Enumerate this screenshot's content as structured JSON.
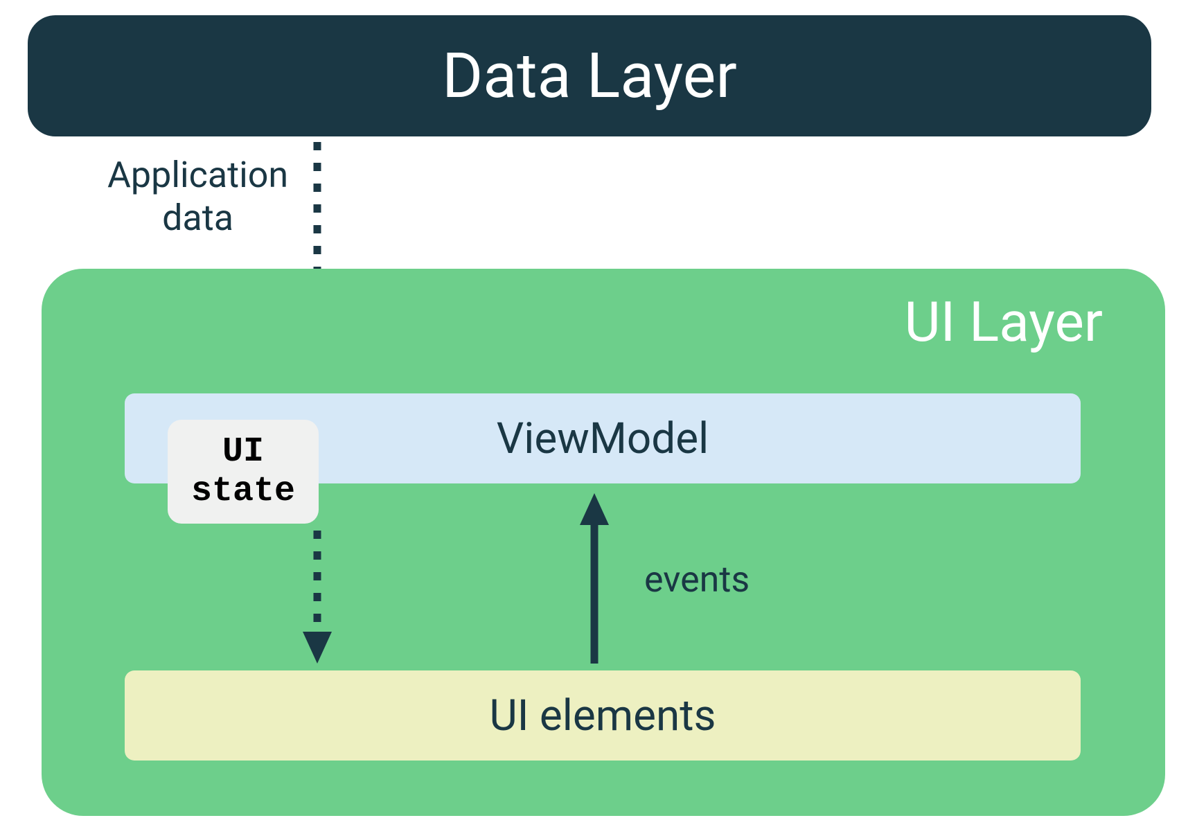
{
  "boxes": {
    "data_layer": "Data Layer",
    "ui_layer": "UI Layer",
    "viewmodel": "ViewModel",
    "ui_state_line1": "UI",
    "ui_state_line2": "state",
    "ui_elements": "UI elements"
  },
  "labels": {
    "application_data_line1": "Application",
    "application_data_line2": "data",
    "events": "events"
  },
  "colors": {
    "dark_navy": "#1a3744",
    "green": "#6dcf8b",
    "light_blue": "#d6e8f7",
    "light_yellow": "#edf0c1",
    "light_gray": "#f0f1f0",
    "white": "#ffffff"
  },
  "arrows": {
    "data_to_viewmodel": {
      "style": "dashed",
      "direction": "down"
    },
    "viewmodel_to_elements": {
      "style": "dashed",
      "direction": "down"
    },
    "elements_to_viewmodel": {
      "style": "solid",
      "direction": "up"
    }
  }
}
